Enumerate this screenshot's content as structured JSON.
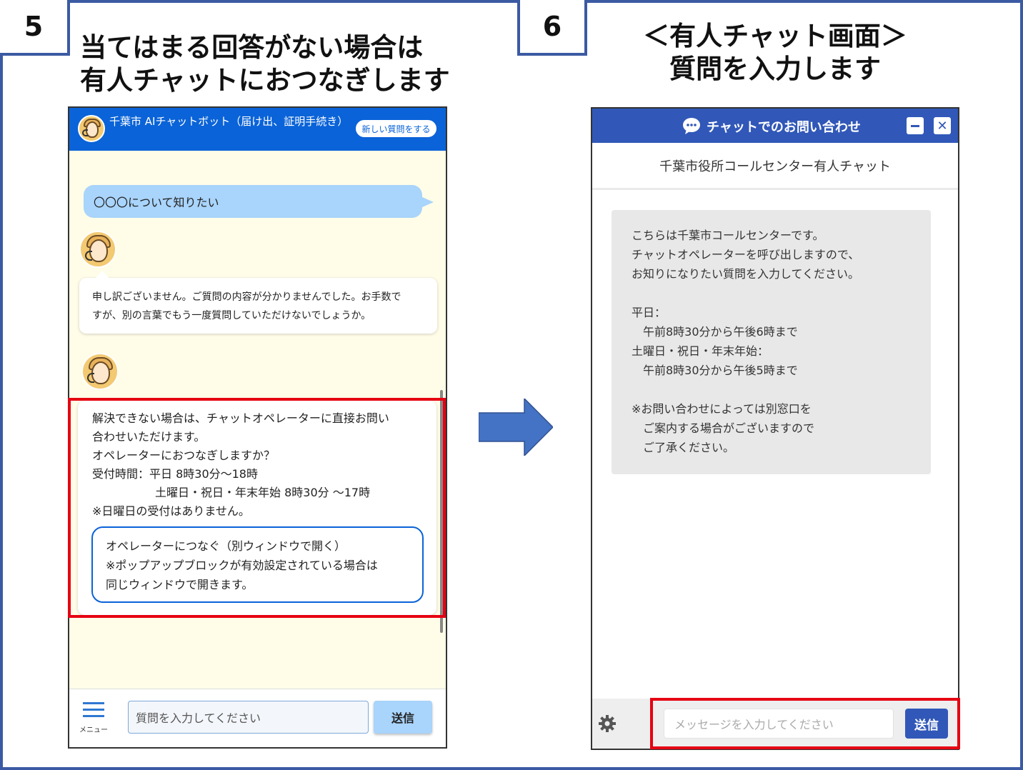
{
  "steps": {
    "left": {
      "number": "5",
      "heading": [
        "当てはまる回答がない場合は",
        "有人チャットにおつなぎします"
      ]
    },
    "right": {
      "number": "6",
      "heading": [
        "＜有人チャット画面＞",
        "質問を入力します"
      ]
    }
  },
  "bot_chat": {
    "header_title": "千葉市 AIチャットボット（届け出、証明手続き）",
    "new_question_button": "新しい質問をする",
    "user_message": "〇〇〇について知りたい",
    "bot_reply_1": [
      "申し訳ございません。ご質問の内容が分かりませんでした。お手数で",
      "すが、別の言葉でもう一度質問していただけないでしょうか。"
    ],
    "bot_reply_2": {
      "lines": [
        "解決できない場合は、チャットオペレーターに直接お問い",
        "合わせいただけます。",
        "オペレーターにおつなぎしますか？",
        "受付時間：平日 8時30分～18時"
      ],
      "indented_line": "土曜日・祝日・年末年始  8時30分 ～17時",
      "note": "※日曜日の受付はありません。",
      "operator_button": [
        "オペレーターにつなぐ（別ウィンドウで開く）",
        "※ポップアップブロックが有効設定されている場合は",
        "同じウィンドウで開きます。"
      ]
    },
    "menu_label": "メニュー",
    "input_placeholder": "質問を入力してください",
    "send_button": "送信"
  },
  "human_chat": {
    "header_title": "チャットでのお問い合わせ",
    "close_label": "✕",
    "sub_header": "千葉市役所コールセンター有人チャット",
    "operator_message": [
      "こちらは千葉市コールセンターです。",
      "チャットオペレーターを呼び出しますので、",
      "お知りになりたい質問を入力してください。",
      "",
      "平日：",
      "　午前8時30分から午後6時まで",
      "土曜日・祝日・年末年始：",
      "　午前8時30分から午後5時まで",
      "",
      "※お問い合わせによっては別窓口を",
      "　ご案内する場合がございますので",
      "　ご了承ください。"
    ],
    "input_placeholder": "メッセージを入力してください",
    "send_button": "送信"
  },
  "colors": {
    "frame": "#3b5aa3",
    "highlight": "#e60012",
    "bot_header": "#0a63d8",
    "human_header": "#3158b8"
  }
}
